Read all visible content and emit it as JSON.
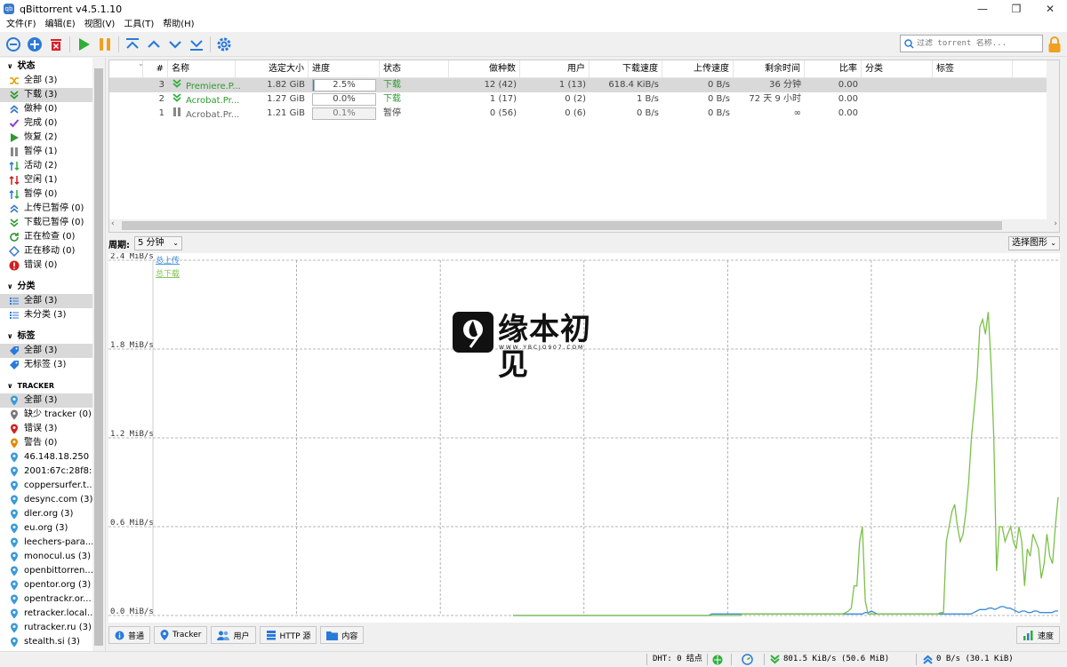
{
  "window": {
    "title": "qBittorrent v4.5.1.10",
    "icon": "qb-logo-icon",
    "icon_text": "qb"
  },
  "menu": [
    "文件(F)",
    "编辑(E)",
    "视图(V)",
    "工具(T)",
    "帮助(H)"
  ],
  "toolbar": {
    "buttons": [
      "add-link",
      "add-torrent",
      "delete",
      "resume",
      "pause",
      "move-top",
      "move-up",
      "move-down",
      "move-bottom",
      "options"
    ],
    "filter_placeholder": "过滤 torrent 名称..."
  },
  "sidebar": {
    "status": {
      "title": "状态",
      "items": [
        {
          "label": "全部 (3)",
          "icon": "shuffle-icon",
          "color": "#e0a000"
        },
        {
          "label": "下载 (3)",
          "icon": "download-icon",
          "color": "#2f9a2f",
          "selected": true
        },
        {
          "label": "做种 (0)",
          "icon": "upload-icon",
          "color": "#3a78c9"
        },
        {
          "label": "完成 (0)",
          "icon": "check-icon",
          "color": "#8a3fc9"
        },
        {
          "label": "恢复 (2)",
          "icon": "play-icon",
          "color": "#2f9a2f"
        },
        {
          "label": "暂停 (1)",
          "icon": "pause-icon",
          "color": "#888888"
        },
        {
          "label": "活动 (2)",
          "icon": "active-icon",
          "color": "#2f9a2f"
        },
        {
          "label": "空闲 (1)",
          "icon": "inactive-icon",
          "color": "#d02020"
        },
        {
          "label": "暂停 (0)",
          "icon": "stalled-icon",
          "color": "#2f9a2f"
        },
        {
          "label": "上传已暂停 (0)",
          "icon": "upload-stalled-icon",
          "color": "#3a78c9"
        },
        {
          "label": "下载已暂停 (0)",
          "icon": "download-stalled-icon",
          "color": "#2f9a2f"
        },
        {
          "label": "正在检查 (0)",
          "icon": "checking-icon",
          "color": "#2f9a2f"
        },
        {
          "label": "正在移动 (0)",
          "icon": "moving-icon",
          "color": "#3a78c9"
        },
        {
          "label": "错误 (0)",
          "icon": "error-icon",
          "color": "#d02020"
        }
      ]
    },
    "categories": {
      "title": "分类",
      "items": [
        {
          "label": "全部 (3)",
          "selected": true
        },
        {
          "label": "未分类 (3)"
        }
      ]
    },
    "tags": {
      "title": "标签",
      "items": [
        {
          "label": "全部 (3)",
          "selected": true
        },
        {
          "label": "无标签 (3)"
        }
      ]
    },
    "trackers": {
      "title": "TRACKER",
      "items": [
        {
          "label": "全部 (3)",
          "color": "#3a9ad9",
          "selected": true
        },
        {
          "label": "缺少 tracker (0)",
          "color": "#777777"
        },
        {
          "label": "错误 (3)",
          "color": "#d02020"
        },
        {
          "label": "警告 (0)",
          "color": "#e08a00"
        },
        {
          "label": "46.148.18.250 ...",
          "color": "#3a9ad9"
        },
        {
          "label": "2001:67c:28f8:...",
          "color": "#3a9ad9"
        },
        {
          "label": "coppersurfer.t...",
          "color": "#3a9ad9"
        },
        {
          "label": "desync.com (3)",
          "color": "#3a9ad9"
        },
        {
          "label": "dler.org (3)",
          "color": "#3a9ad9"
        },
        {
          "label": "eu.org (3)",
          "color": "#3a9ad9"
        },
        {
          "label": "leechers-para...",
          "color": "#3a9ad9"
        },
        {
          "label": "monocul.us (3)",
          "color": "#3a9ad9"
        },
        {
          "label": "openbittorren...",
          "color": "#3a9ad9"
        },
        {
          "label": "opentor.org (3)",
          "color": "#3a9ad9"
        },
        {
          "label": "opentrackr.or...",
          "color": "#3a9ad9"
        },
        {
          "label": "retracker.local...",
          "color": "#3a9ad9"
        },
        {
          "label": "rutracker.ru (3)",
          "color": "#3a9ad9"
        },
        {
          "label": "stealth.si (3)",
          "color": "#3a9ad9"
        }
      ]
    }
  },
  "table": {
    "headers": [
      "#",
      "名称",
      "选定大小",
      "进度",
      "状态",
      "做种数",
      "用户",
      "下载速度",
      "上传速度",
      "剩余时间",
      "比率",
      "分类",
      "标签"
    ],
    "rows": [
      {
        "num": "3",
        "name": "Premiere.P...",
        "size": "1.82 GiB",
        "progress": "2.5%",
        "progress_frac": 0.025,
        "status": "下载",
        "seeds": "12 (42)",
        "peers": "1 (13)",
        "dl": "618.4 KiB/s",
        "ul": "0 B/s",
        "eta": "36 分钟",
        "ratio": "0.00",
        "state": "downloading",
        "selected": true
      },
      {
        "num": "2",
        "name": "Acrobat.Pr...",
        "size": "1.27 GiB",
        "progress": "0.0%",
        "progress_frac": 0.0,
        "status": "下载",
        "seeds": "1 (17)",
        "peers": "0 (2)",
        "dl": "1 B/s",
        "ul": "0 B/s",
        "eta": "72 天 9 小时",
        "ratio": "0.00",
        "state": "downloading"
      },
      {
        "num": "1",
        "name": "Acrobat.Pr...",
        "size": "1.21 GiB",
        "progress": "0.1%",
        "progress_frac": 0.001,
        "status": "暂停",
        "seeds": "0 (56)",
        "peers": "0 (6)",
        "dl": "0 B/s",
        "ul": "0 B/s",
        "eta": "∞",
        "ratio": "0.00",
        "state": "paused"
      }
    ]
  },
  "graph_controls": {
    "period_label": "周期:",
    "period_value": "5 分钟",
    "select_graph": "选择图形"
  },
  "chart_data": {
    "type": "line",
    "y_ticks": [
      "2.4 MiB/s",
      "1.8 MiB/s",
      "1.2 MiB/s",
      "0.6 MiB/s",
      "0.0 MiB/s"
    ],
    "ylim": [
      0,
      2.4
    ],
    "grid": true,
    "legend_position": "top-left",
    "series": [
      {
        "name": "总上传",
        "color": "#3a8ad9",
        "values": [
          0,
          0,
          0,
          0,
          0,
          0,
          0,
          0,
          0,
          0,
          0,
          0,
          0,
          0,
          0,
          0,
          0,
          0,
          0,
          0,
          0,
          0,
          0,
          0,
          0,
          0,
          0,
          0,
          0,
          0,
          0,
          0,
          0,
          0,
          0,
          0,
          0,
          0,
          0,
          0,
          0,
          0,
          0,
          0,
          0,
          0,
          0,
          0,
          0,
          0,
          0,
          0,
          0,
          0,
          0,
          0,
          0,
          0,
          0,
          0,
          0,
          0,
          0,
          0,
          0,
          0,
          0.01,
          0.01,
          0.01,
          0.01,
          0.01,
          0.01,
          0.01,
          0.01,
          0.01,
          0.01,
          0.01,
          0.01,
          0.01,
          0.01,
          0.01,
          0.01,
          0.01,
          0.01,
          0.01,
          0.01,
          0.01,
          0.01,
          0.01,
          0.01,
          0.01,
          0.01,
          0.01,
          0.01,
          0.01,
          0.01,
          0.01,
          0.01,
          0.01,
          0.01,
          0.01,
          0.01,
          0.01,
          0.01,
          0.01,
          0.01,
          0.01,
          0.01,
          0.01,
          0.01,
          0.01,
          0.01,
          0.01,
          0.01,
          0.01,
          0.01,
          0.01,
          0.02,
          0.02,
          0.03,
          0.02,
          0.01,
          0.01,
          0.01,
          0.01,
          0.01,
          0.01,
          0.01,
          0.01,
          0.01,
          0.01,
          0.01,
          0.01,
          0.01,
          0.01,
          0.01,
          0.01,
          0.01,
          0.01,
          0.01,
          0.01,
          0.01,
          0.01,
          0.01,
          0.01,
          0.01,
          0.01,
          0.01,
          0.01,
          0.01,
          0.01,
          0.01,
          0.01,
          0.02,
          0.03,
          0.04,
          0.04,
          0.04,
          0.05,
          0.05,
          0.04,
          0.05,
          0.06,
          0.06,
          0.05,
          0.05,
          0.04,
          0.03,
          0.02,
          0.03,
          0.03,
          0.02,
          0.02,
          0.03,
          0.03,
          0.02,
          0.02,
          0.02,
          0.02,
          0.02,
          0.03,
          0.03
        ]
      },
      {
        "name": "总下载",
        "color": "#7cc04a",
        "values": [
          0,
          0,
          0,
          0,
          0,
          0,
          0,
          0,
          0,
          0,
          0,
          0,
          0,
          0,
          0,
          0,
          0,
          0,
          0,
          0,
          0,
          0,
          0,
          0,
          0,
          0,
          0,
          0,
          0,
          0,
          0,
          0,
          0,
          0,
          0,
          0,
          0,
          0,
          0,
          0,
          0,
          0,
          0,
          0,
          0,
          0,
          0,
          0,
          0,
          0,
          0,
          0,
          0,
          0,
          0,
          0,
          0,
          0,
          0,
          0,
          0,
          0,
          0,
          0,
          0,
          0,
          0,
          0,
          0,
          0,
          0,
          0,
          0,
          0,
          0,
          0,
          0,
          0,
          0,
          0,
          0,
          0,
          0.01,
          0.01,
          0.01,
          0.01,
          0.01,
          0.01,
          0.01,
          0.01,
          0.01,
          0.01,
          0.01,
          0.01,
          0.01,
          0.01,
          0.01,
          0.01,
          0.01,
          0.01,
          0.01,
          0.01,
          0.01,
          0.01,
          0.01,
          0.01,
          0.01,
          0.01,
          0.01,
          0.01,
          0.01,
          0.01,
          0.01,
          0.01,
          0.01,
          0.01,
          0.01,
          0.01,
          0.01,
          0.02,
          0.03,
          0.05,
          0.2,
          0.2,
          0.5,
          0.6,
          0.1,
          0.01,
          0.01,
          0.01,
          0.01,
          0.01,
          0.01,
          0.01,
          0.01,
          0.01,
          0.01,
          0.01,
          0.01,
          0.01,
          0.01,
          0.01,
          0.01,
          0.01,
          0.01,
          0.01,
          0.01,
          0.01,
          0.01,
          0.01,
          0.01,
          0.01,
          0.01,
          0.02,
          0.02,
          0.5,
          0.6,
          0.7,
          0.75,
          0.6,
          0.5,
          0.55,
          0.7,
          0.9,
          1.2,
          1.4,
          1.6,
          1.95,
          2.0,
          1.9,
          2.05,
          1.7,
          1.2,
          0.3,
          0.6,
          0.6,
          0.5,
          0.55,
          0.6,
          0.5,
          0.45,
          0.6,
          0.5,
          0.2,
          0.45,
          0.4,
          0.55,
          0.5,
          0.45,
          0.25,
          0.35,
          0.55,
          0.4,
          0.35,
          0.6,
          0.8
        ]
      }
    ]
  },
  "watermark": {
    "title": "缘本初见",
    "url": "W W W . Y B C J O 9 0 7 . C O M"
  },
  "tabs": [
    {
      "label": "普通",
      "icon": "info-icon"
    },
    {
      "label": "Tracker",
      "icon": "tracker-pin-icon"
    },
    {
      "label": "用户",
      "icon": "users-icon"
    },
    {
      "label": "HTTP 源",
      "icon": "server-icon"
    },
    {
      "label": "内容",
      "icon": "folder-icon"
    }
  ],
  "speed_tab": {
    "label": "速度",
    "icon": "chart-icon"
  },
  "statusbar": {
    "dht": "DHT: 0 结点",
    "download": "801.5 KiB/s (50.6 MiB)",
    "upload": "0 B/s (30.1 KiB)"
  }
}
